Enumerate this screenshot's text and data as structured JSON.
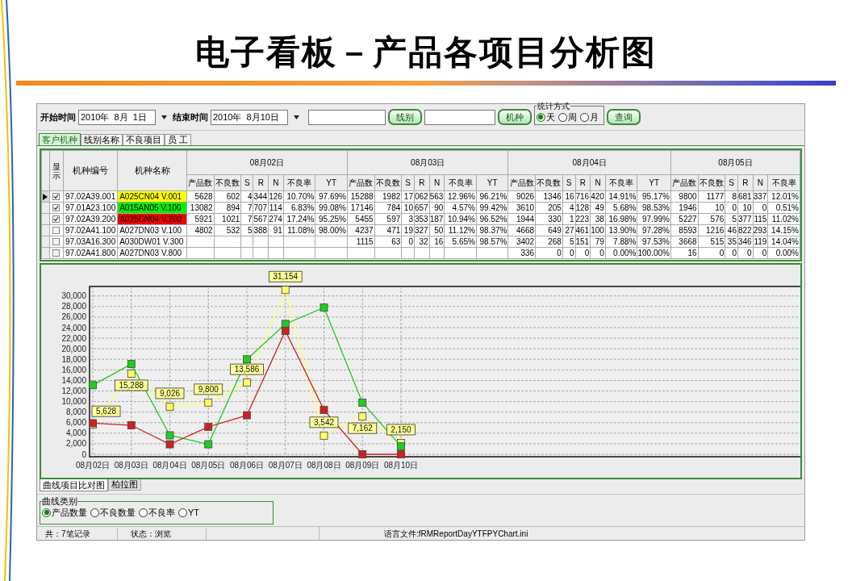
{
  "slide": {
    "title": "电子看板－产品各项目分析图"
  },
  "toolbar": {
    "start_label": "开始时间",
    "start_date": "2010年  8月  1日",
    "end_label": "结束时间",
    "end_date": "2010年  8月10日",
    "line_button": "线别",
    "model_button": "机种",
    "query_button": "查询",
    "stat_mode": {
      "title": "统计方式",
      "options": [
        {
          "label": "天",
          "selected": true
        },
        {
          "label": "周",
          "selected": false
        },
        {
          "label": "月",
          "selected": false
        }
      ]
    }
  },
  "tabs": [
    {
      "label": "客户机种",
      "selected": true
    },
    {
      "label": "线别名称",
      "selected": false
    },
    {
      "label": "不良项目",
      "selected": false
    },
    {
      "label": "员 工",
      "selected": false
    }
  ],
  "table": {
    "columns": {
      "show": "显示",
      "model_code": "机种编号",
      "model_name": "机种名称"
    },
    "day_groups": [
      {
        "date": "08月02日",
        "subcolumns": [
          "产品数",
          "不良数",
          "S",
          "R",
          "N",
          "不良率",
          "YT"
        ]
      },
      {
        "date": "08月03日",
        "subcolumns": [
          "产品数",
          "不良数",
          "S",
          "R",
          "N",
          "不良率",
          "YT"
        ]
      },
      {
        "date": "08月04日",
        "subcolumns": [
          "产品数",
          "不良数",
          "S",
          "R",
          "N",
          "不良率",
          "YT"
        ]
      },
      {
        "date": "08月05日",
        "subcolumns": [
          "产品数",
          "不良数",
          "S",
          "R",
          "N",
          "不良率"
        ]
      }
    ],
    "rows": [
      {
        "selected": true,
        "checked": true,
        "code": "97.02A39.001",
        "name": "A025CN04 V.001",
        "color": "#ffff00",
        "days": {
          "day_1": [
            "5628",
            "602",
            "4",
            "344",
            "126",
            "10.70%",
            "97.69%"
          ],
          "day_2": [
            "15288",
            "1982",
            "17",
            "062",
            "563",
            "12.96%",
            "96.21%"
          ],
          "day_3": [
            "9026",
            "1346",
            "16",
            "716",
            "420",
            "14.91%",
            "95.17%"
          ],
          "day_4": [
            "9800",
            "1177",
            "8",
            "681",
            "337",
            "12.01%"
          ]
        }
      },
      {
        "selected": false,
        "checked": true,
        "code": "97.01A23.100",
        "name": "A015AN05 V.100",
        "color": "#00ee00",
        "days": {
          "day_1": [
            "13082",
            "894",
            "7",
            "707",
            "114",
            "6.83%",
            "99.08%"
          ],
          "day_2": [
            "17146",
            "784",
            "10",
            "657",
            "90",
            "4.57%",
            "99.42%"
          ],
          "day_3": [
            "3610",
            "205",
            "4",
            "128",
            "49",
            "5.68%",
            "98.53%"
          ],
          "day_4": [
            "1946",
            "10",
            "0",
            "10",
            "0",
            "0.51%"
          ]
        }
      },
      {
        "selected": false,
        "checked": true,
        "code": "97.02A39.200",
        "name": "A025CN04 V.200",
        "color": "#ee0000",
        "days": {
          "day_1": [
            "5921",
            "1021",
            "7",
            "567",
            "274",
            "17.24%",
            "95.25%"
          ],
          "day_2": [
            "5455",
            "597",
            "3",
            "353",
            "187",
            "10.94%",
            "96.52%"
          ],
          "day_3": [
            "1944",
            "330",
            "1",
            "223",
            "38",
            "16.98%",
            "97.99%"
          ],
          "day_4": [
            "5227",
            "576",
            "5",
            "377",
            "115",
            "11.02%"
          ]
        }
      },
      {
        "selected": false,
        "checked": false,
        "code": "97.02A41.100",
        "name": "A027DN03 V.100",
        "days": {
          "day_1": [
            "4802",
            "532",
            "5",
            "388",
            "91",
            "11.08%",
            "98.00%"
          ],
          "day_2": [
            "4237",
            "471",
            "19",
            "327",
            "50",
            "11.12%",
            "98.37%"
          ],
          "day_3": [
            "4668",
            "649",
            "27",
            "461",
            "100",
            "13.90%",
            "97.28%"
          ],
          "day_4": [
            "8593",
            "1216",
            "46",
            "822",
            "293",
            "14.15%"
          ]
        }
      },
      {
        "selected": false,
        "checked": false,
        "code": "97.03A16.300",
        "name": "A030DW01 V.300",
        "days": {
          "day_2": [
            "1115",
            "63",
            "0",
            "32",
            "16",
            "5.65%",
            "98.57%"
          ],
          "day_3": [
            "3402",
            "268",
            "5",
            "151",
            "79",
            "7.88%",
            "97.53%"
          ],
          "day_4": [
            "3668",
            "515",
            "35",
            "346",
            "119",
            "14.04%"
          ]
        }
      },
      {
        "selected": false,
        "checked": false,
        "code": "97.02A41.800",
        "name": "A027DN03 V.800",
        "days": {
          "day_3": [
            "336",
            "0",
            "0",
            "0",
            "0",
            "0.00%",
            "100.00%"
          ],
          "day_4": [
            "16",
            "0",
            "0",
            "0",
            "0",
            "0.00%"
          ]
        }
      }
    ]
  },
  "chart": {
    "chart_data": {
      "type": "line",
      "categories": [
        "08月02日",
        "08月03日",
        "08月04日",
        "08月05日",
        "08月06日",
        "08月07日",
        "08月08日",
        "08月09日",
        "08月10日"
      ],
      "ylim": [
        0,
        31800
      ],
      "grid": true,
      "yticks": [
        {
          "value": 0,
          "label": "0"
        },
        {
          "value": 2000,
          "label": "2,000"
        },
        {
          "value": 4000,
          "label": "4,000"
        },
        {
          "value": 6000,
          "label": "6,000"
        },
        {
          "value": 8000,
          "label": "8,000"
        },
        {
          "value": 10000,
          "label": "10,000"
        },
        {
          "value": 12000,
          "label": "12,000"
        },
        {
          "value": 14000,
          "label": "14,000"
        },
        {
          "value": 16000,
          "label": "16,000"
        },
        {
          "value": 18000,
          "label": "18,000"
        },
        {
          "value": 20000,
          "label": "20,000"
        },
        {
          "value": 22000,
          "label": "22,000"
        },
        {
          "value": 24000,
          "label": "24,000"
        },
        {
          "value": 26000,
          "label": "26,000"
        },
        {
          "value": 28000,
          "label": "28,000"
        },
        {
          "value": 30000,
          "label": "30,000"
        }
      ],
      "series": [
        {
          "color": "#ffff66",
          "marker": "square",
          "values": [
            5628,
            15288,
            9026,
            9800,
            13586,
            31154,
            3542,
            7162,
            2150
          ],
          "value_labels": [
            "5,628",
            "15,288",
            "9,026",
            "9,800",
            "13,586",
            "31,154",
            "3,542",
            "7,162",
            "2,150"
          ]
        },
        {
          "color": "#22cc22",
          "marker": "square",
          "values": [
            13100,
            17100,
            3600,
            1900,
            18000,
            24700,
            27800,
            9800,
            1500
          ]
        },
        {
          "color": "#cc2222",
          "marker": "square",
          "values": [
            5900,
            5500,
            1900,
            5200,
            7400,
            23400,
            8400,
            0,
            0
          ]
        }
      ]
    }
  },
  "chart_tabs": [
    {
      "label": "曲线项目比对图",
      "selected": true
    },
    {
      "label": "柏拉图",
      "selected": false
    }
  ],
  "curve_type": {
    "title": "曲线类别",
    "options": [
      {
        "label": "产品数量",
        "selected": true
      },
      {
        "label": "不良数量",
        "selected": false
      },
      {
        "label": "不良率",
        "selected": false
      },
      {
        "label": "YT",
        "selected": false
      }
    ]
  },
  "status_bar": [
    "共：7笔记录",
    "状态：浏览",
    "语言文件:fRMReportDayYTFPYChart.ini"
  ]
}
